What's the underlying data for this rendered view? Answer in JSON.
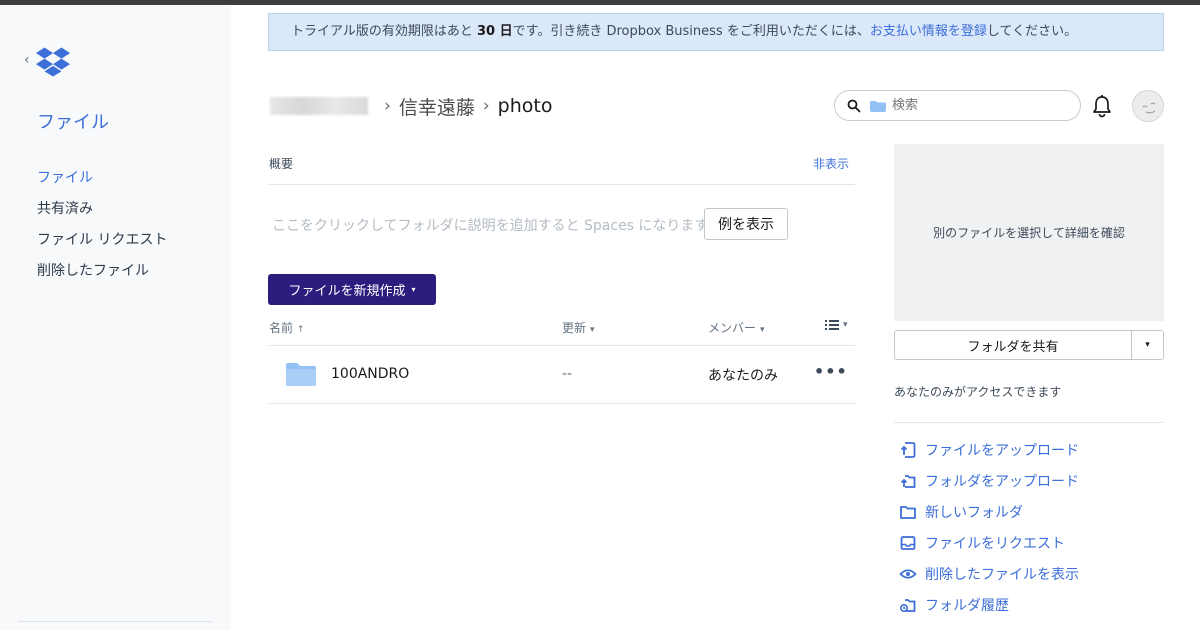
{
  "sidebar": {
    "back_glyph": "‹",
    "logo_icon": "dropbox-logo-icon",
    "section_title": "ファイル",
    "items": [
      {
        "label": "ファイル",
        "active": true
      },
      {
        "label": "共有済み",
        "active": false
      },
      {
        "label": "ファイル リクエスト",
        "active": false
      },
      {
        "label": "削除したファイル",
        "active": false
      }
    ]
  },
  "banner": {
    "prefix": "トライアル版の有効期限はあと ",
    "days": "30 日",
    "middle": "です。引き続き Dropbox Business をご利用いただくには、",
    "link": "お支払い情報を登録",
    "suffix": "してください。"
  },
  "breadcrumb": {
    "sep": "›",
    "folder": "信幸遠藤",
    "current": "photo"
  },
  "search": {
    "placeholder": "検索"
  },
  "overview": {
    "label": "概要",
    "hide_link": "非表示",
    "description_placeholder": "ここをクリックしてフォルダに説明を追加すると Spaces になります",
    "example_button": "例を表示"
  },
  "new_file_button": {
    "label": "ファイルを新規作成",
    "caret": "▾"
  },
  "table": {
    "headers": {
      "name": "名前",
      "name_arrow": "↑",
      "updated": "更新",
      "updated_arrow": "▾",
      "members": "メンバー",
      "members_arrow": "▾",
      "view_arrow": "▾"
    },
    "rows": [
      {
        "name": "100ANDRO",
        "updated": "--",
        "members": "あなたのみ",
        "more": "•••"
      }
    ]
  },
  "details": {
    "placeholder": "別のファイルを選択して詳細を確認",
    "share_button": "フォルダを共有",
    "share_caret": "▾",
    "access_note": "あなたのみがアクセスできます",
    "actions": [
      {
        "label": "ファイルをアップロード",
        "icon": "upload-file-icon"
      },
      {
        "label": "フォルダをアップロード",
        "icon": "upload-folder-icon"
      },
      {
        "label": "新しいフォルダ",
        "icon": "new-folder-icon"
      },
      {
        "label": "ファイルをリクエスト",
        "icon": "request-file-icon"
      },
      {
        "label": "削除したファイルを表示",
        "icon": "eye-icon"
      },
      {
        "label": "フォルダ履歴",
        "icon": "folder-history-icon"
      }
    ]
  },
  "colors": {
    "accent": "#3d6fd8",
    "primary_button": "#2d1b7e",
    "banner_bg": "#dbe8f9",
    "folder": "#92c1f5"
  }
}
